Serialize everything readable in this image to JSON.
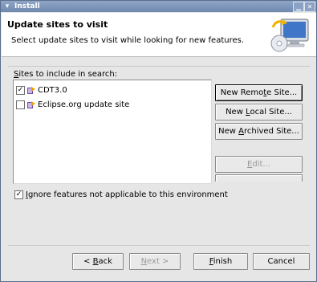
{
  "window": {
    "title": "Install",
    "menu_icon": "chevron-down-icon",
    "min_icon": "minimize-icon",
    "close_icon": "close-icon"
  },
  "header": {
    "title": "Update sites to visit",
    "description": "Select update sites to visit while looking for new features.",
    "icon": "install-computer-icon"
  },
  "sites": {
    "label_mnemonic": "S",
    "label_rest": "ites to include in search:",
    "items": [
      {
        "label": "CDT3.0",
        "checked": true,
        "icon": "update-site-icon"
      },
      {
        "label": "Eclipse.org update site",
        "checked": false,
        "icon": "update-site-icon"
      }
    ]
  },
  "buttons": {
    "new_remote": {
      "pre": "New Remo",
      "mn": "t",
      "post": "e Site..."
    },
    "new_local": {
      "pre": "New ",
      "mn": "L",
      "post": "ocal Site..."
    },
    "new_archived": {
      "pre": "New ",
      "mn": "A",
      "post": "rchived Site..."
    },
    "edit": {
      "pre": "",
      "mn": "E",
      "post": "dit..."
    }
  },
  "ignore": {
    "checked": true,
    "mn": "I",
    "rest": "gnore features not applicable to this environment"
  },
  "footer": {
    "back": {
      "pre": "< ",
      "mn": "B",
      "post": "ack"
    },
    "next": {
      "pre": "",
      "mn": "N",
      "post": "ext >"
    },
    "finish": {
      "pre": "",
      "mn": "F",
      "post": "inish"
    },
    "cancel": "Cancel"
  }
}
